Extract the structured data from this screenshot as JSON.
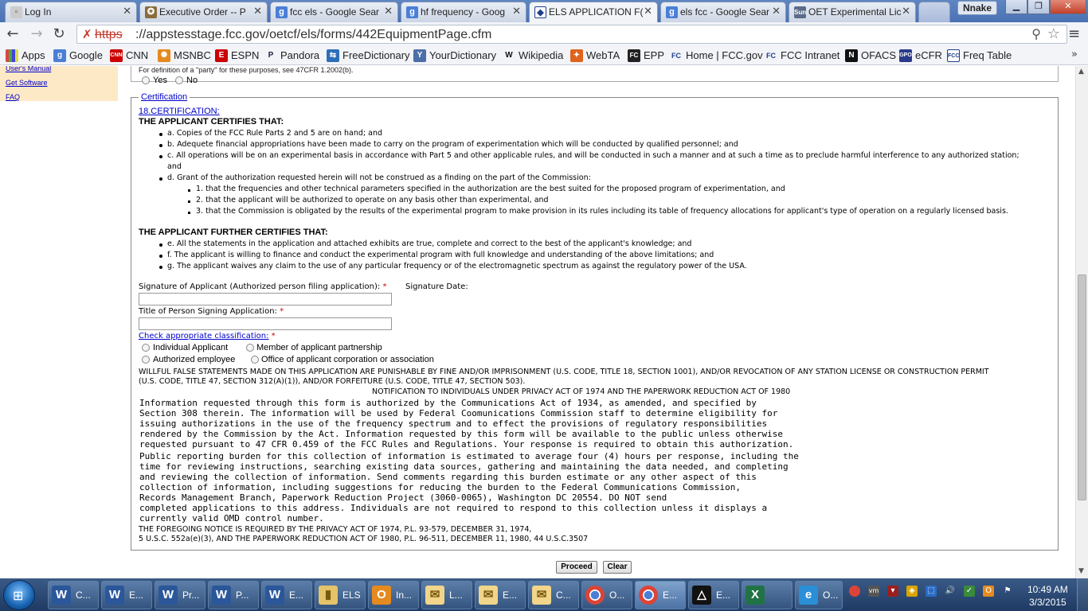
{
  "browser": {
    "tabs": [
      {
        "label": "Log In",
        "icon": "page-icon"
      },
      {
        "label": "Executive Order -- P",
        "icon": "seal-icon"
      },
      {
        "label": "fcc els - Google Sear",
        "icon": "google-icon"
      },
      {
        "label": "hf frequency - Goog",
        "icon": "google-icon"
      },
      {
        "label": "ELS APPLICATION F(",
        "icon": "fcc-icon"
      },
      {
        "label": "els fcc - Google Sear",
        "icon": "google-icon"
      },
      {
        "label": "OET Experimental Lic",
        "icon": "sun-icon"
      }
    ],
    "user": "Nnake",
    "url_scheme": "https",
    "url_rest": "://appstesstage.fcc.gov/oetcf/els/forms/442EquipmentPage.cfm",
    "bookmarks": [
      "Apps",
      "Google",
      "CNN",
      "MSNBC",
      "ESPN",
      "Pandora",
      "FreeDictionary",
      "YourDictionary",
      "Wikipedia",
      "WebTA",
      "EPP",
      "Home | FCC.gov",
      "FCC Intranet",
      "OFACS",
      "eCFR",
      "Freq Table"
    ]
  },
  "sidebar": {
    "links": [
      "User's Manual",
      "Get Software",
      "FAQ"
    ]
  },
  "previous": {
    "text": "For definition of a \"party\" for these purposes, see 47CFR 1.2002(b).",
    "yes": "Yes",
    "no": "No"
  },
  "certification": {
    "legend": "Certification",
    "section_link": "18.CERTIFICATION:",
    "heading1": "THE APPLICANT CERTIFIES THAT:",
    "items1": [
      "a. Copies of the FCC Rule Parts 2 and 5 are on hand; and",
      "b. Adequete financial appropriations have been made to carry on the program of experimentation which will be conducted by qualified personnel; and",
      "c. All operations will be on an experimental basis in accordance with Part 5 and other applicable rules, and will be conducted in such a manner and at such a time as to preclude harmful interference to any authorized station;",
      "and",
      "d. Grant of the authorization requested herein will not be construed as a finding on the part of the Commission:"
    ],
    "subitems": [
      "1. that the frequencies and other technical parameters specified in the authorization are the best suited for the proposed program of experimentation, and",
      "2. that the applicant will be authorized to operate on any basis other than experimental, and",
      "3. that the Commission is obligated by the results of the experimental program to make provision in its rules including its table of frequency allocations for applicant's type of operation on a regularly licensed basis."
    ],
    "heading2": "THE APPLICANT FURTHER CERTIFIES THAT:",
    "items2": [
      "e. All the statements in the application and attached exhibits are true, complete and correct to the best of the applicant's knowledge; and",
      "f. The applicant is willing to finance and conduct the experimental program with full knowledge and understanding of the above limitations; and",
      "g. The applicant waives any claim to the use of any particular frequency or of the electromagnetic spectrum as against the regulatory power of the USA."
    ],
    "signature_label": "Signature of Applicant (Authorized person filing application):",
    "signature_date_label": "Signature Date:",
    "title_label": "Title of Person Signing Application:",
    "required_mark": "*",
    "classification_link": "Check appropriate classification:",
    "classifications": [
      "Individual Applicant",
      "Member of applicant partnership",
      "Authorized employee",
      "Office of applicant corporation or association"
    ],
    "willful_line1": "WILLFUL FALSE STATEMENTS MADE ON THIS APPLICATION ARE PUNISHABLE BY FINE AND/OR IMPRISONMENT (U.S. CODE, TITLE 18, SECTION 1001), AND/OR REVOCATION OF ANY STATION LICENSE OR CONSTRUCTION PERMIT",
    "willful_line2": "(U.S. CODE, TITLE 47, SECTION 312(A)(1)), AND/OR FORFEITURE (U.S. CODE, TITLE 47, SECTION 503).",
    "privacy_heading": "NOTIFICATION TO INDIVIDUALS UNDER PRIVACY ACT OF 1974 AND THE PAPERWORK REDUCTION ACT OF 1980",
    "info_para": "Information requested through this form is authorized by the Communications Act of 1934, as amended, and specified by\nSection 308 therein. The information will be used by Federal Coomunications Commission staff to determine eligibility for\nissuing authorizations in the use of the frequency spectrum and to effect the provisions of regulatory responsibilities\nrendered by the Commission by the Act. Information requested by this form will be available to the public unless otherwise\nrequested pursuant to 47 CFR 0.459 of the FCC Rules and Regulations. Your response is required to obtain this authorization.",
    "burden_para": "Public reporting burden for this collection of information is estimated to average four (4) hours per response, including the\ntime for reviewing instructions, searching existing data sources, gathering and maintaining the data needed, and completing\nand reviewing the collection of information. Send comments regarding this burden estimate or any other aspect of this\ncollection of information, including suggestions for reducing the burden to the Federal Communications Commission,\nRecords Management Branch, Paperwork Reduction Project (3060-0065), Washington DC 20554. DO NOT send\ncompleted applications to this address. Individuals are not required to respond to this collection unless it displays a\ncurrently valid OMD control number.",
    "notice_line1": "THE FOREGOING NOTICE IS REQUIRED BY THE PRIVACY ACT OF 1974, P.L. 93-579, DECEMBER 31, 1974,",
    "notice_line2": "5 U.S.C. 552a(e)(3), AND THE PAPERWORK REDUCTION ACT OF 1980, P.L. 96-511, DECEMBER 11, 1980, 44 U.S.C.3507"
  },
  "buttons": {
    "proceed": "Proceed",
    "clear": "Clear"
  },
  "taskbar": {
    "items": [
      "C...",
      "E...",
      "Pr...",
      "P...",
      "E...",
      "ELS",
      "In...",
      "L...",
      "E...",
      "C...",
      "O...",
      "E...",
      "E...",
      "",
      "O..."
    ],
    "time": "10:49 AM",
    "date": "3/3/2015"
  }
}
